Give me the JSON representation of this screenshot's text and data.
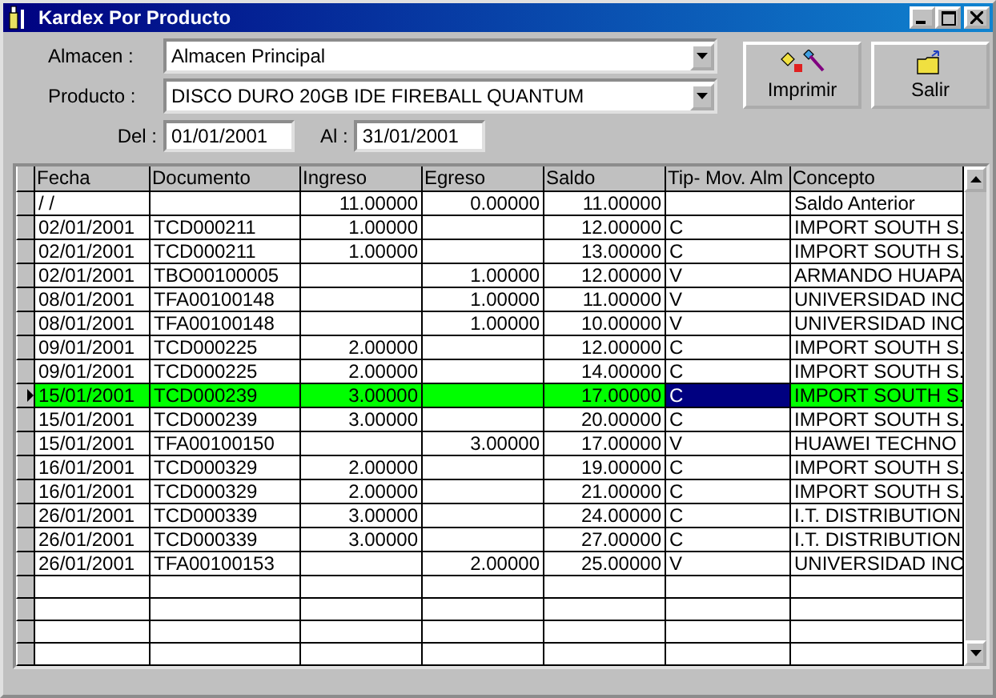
{
  "window": {
    "title": "Kardex  Por Producto"
  },
  "form": {
    "almacen": {
      "label": "Almacen  :",
      "value": "Almacen Principal"
    },
    "producto": {
      "label": "Producto :",
      "value": "DISCO DURO 20GB IDE FIREBALL QUANTUM"
    },
    "del": {
      "label": "Del :",
      "value": "01/01/2001"
    },
    "al": {
      "label": "Al :",
      "value": "31/01/2001"
    }
  },
  "buttons": [
    {
      "label": "Imprimir",
      "kind": "print"
    },
    {
      "label": "Salir",
      "kind": "exit"
    }
  ],
  "table": {
    "columns": [
      {
        "label": "Fecha",
        "selected": false
      },
      {
        "label": "Documento",
        "selected": false
      },
      {
        "label": "Ingreso",
        "selected": false
      },
      {
        "label": "Egreso",
        "selected": false
      },
      {
        "label": "Saldo",
        "selected": false
      },
      {
        "label": "Tip- Mov. Alm",
        "selected": true
      },
      {
        "label": "Concepto",
        "selected": false
      }
    ],
    "rows": [
      {
        "selected": false,
        "fecha": "/ /",
        "ingreso": "11.00000",
        "egreso": "0.00000",
        "saldo": "11.00000",
        "concepto": "Saldo Anterior"
      },
      {
        "selected": false,
        "fecha": "02/01/2001",
        "documento": "TCD000211",
        "ingreso": "1.00000",
        "saldo": "12.00000",
        "tip": "C",
        "concepto": "IMPORT SOUTH S."
      },
      {
        "selected": false,
        "fecha": "02/01/2001",
        "documento": "TCD000211",
        "ingreso": "1.00000",
        "saldo": "13.00000",
        "tip": "C",
        "concepto": "IMPORT SOUTH S."
      },
      {
        "selected": false,
        "fecha": "02/01/2001",
        "documento": "TBO00100005",
        "egreso": "1.00000",
        "saldo": "12.00000",
        "tip": "V",
        "concepto": "ARMANDO HUAPA"
      },
      {
        "selected": false,
        "fecha": "08/01/2001",
        "documento": "TFA00100148",
        "egreso": "1.00000",
        "saldo": "11.00000",
        "tip": "V",
        "concepto": "UNIVERSIDAD INC"
      },
      {
        "selected": false,
        "fecha": "08/01/2001",
        "documento": "TFA00100148",
        "egreso": "1.00000",
        "saldo": "10.00000",
        "tip": "V",
        "concepto": "UNIVERSIDAD INC"
      },
      {
        "selected": false,
        "fecha": "09/01/2001",
        "documento": "TCD000225",
        "ingreso": "2.00000",
        "saldo": "12.00000",
        "tip": "C",
        "concepto": "IMPORT SOUTH S."
      },
      {
        "selected": false,
        "fecha": "09/01/2001",
        "documento": "TCD000225",
        "ingreso": "2.00000",
        "saldo": "14.00000",
        "tip": "C",
        "concepto": "IMPORT SOUTH S."
      },
      {
        "selected": true,
        "fecha": "15/01/2001",
        "documento": "TCD000239",
        "ingreso": "3.00000",
        "saldo": "17.00000",
        "tip": "C",
        "concepto": "IMPORT SOUTH S."
      },
      {
        "selected": false,
        "fecha": "15/01/2001",
        "documento": "TCD000239",
        "ingreso": "3.00000",
        "saldo": "20.00000",
        "tip": "C",
        "concepto": "IMPORT SOUTH S."
      },
      {
        "selected": false,
        "fecha": "15/01/2001",
        "documento": "TFA00100150",
        "egreso": "3.00000",
        "saldo": "17.00000",
        "tip": "V",
        "concepto": "HUAWEI TECHNO"
      },
      {
        "selected": false,
        "fecha": "16/01/2001",
        "documento": "TCD000329",
        "ingreso": "2.00000",
        "saldo": "19.00000",
        "tip": "C",
        "concepto": "IMPORT SOUTH S."
      },
      {
        "selected": false,
        "fecha": "16/01/2001",
        "documento": "TCD000329",
        "ingreso": "2.00000",
        "saldo": "21.00000",
        "tip": "C",
        "concepto": "IMPORT SOUTH S."
      },
      {
        "selected": false,
        "fecha": "26/01/2001",
        "documento": "TCD000339",
        "ingreso": "3.00000",
        "saldo": "24.00000",
        "tip": "C",
        "concepto": "I.T. DISTRIBUTION"
      },
      {
        "selected": false,
        "fecha": "26/01/2001",
        "documento": "TCD000339",
        "ingreso": "3.00000",
        "saldo": "27.00000",
        "tip": "C",
        "concepto": "I.T. DISTRIBUTION"
      },
      {
        "selected": false,
        "fecha": "26/01/2001",
        "documento": "TFA00100153",
        "egreso": "2.00000",
        "saldo": "25.00000",
        "tip": "V",
        "concepto": "UNIVERSIDAD INC"
      }
    ]
  }
}
